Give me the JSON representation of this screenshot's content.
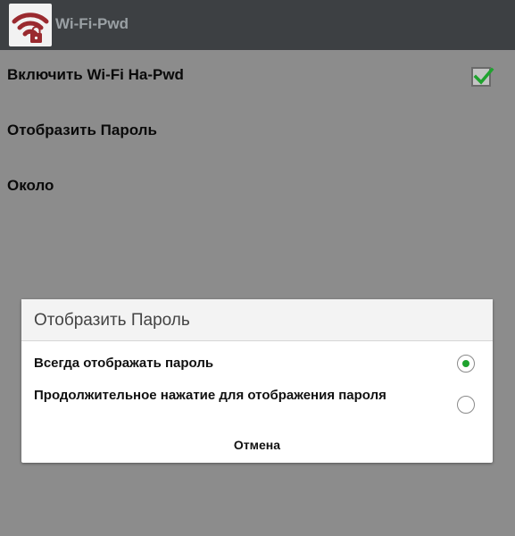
{
  "app": {
    "title": "Wi-Fi-Pwd",
    "icon": "wifi-lock-icon",
    "icon_color": "#9a2a2f"
  },
  "preferences": [
    {
      "label": "Включить Wi-Fi На-Pwd",
      "checked": true
    },
    {
      "label": "Отобразить Пароль"
    },
    {
      "label": "Около"
    }
  ],
  "dialog": {
    "title": "Отобразить Пароль",
    "options": [
      {
        "label": "Всегда отображать пароль",
        "selected": true
      },
      {
        "label": "Продолжительное нажатие  для отображения пароля",
        "selected": false
      }
    ],
    "cancel_label": "Отмена"
  },
  "colors": {
    "accent_green": "#1fa32e",
    "topbar": "#3d4043"
  }
}
